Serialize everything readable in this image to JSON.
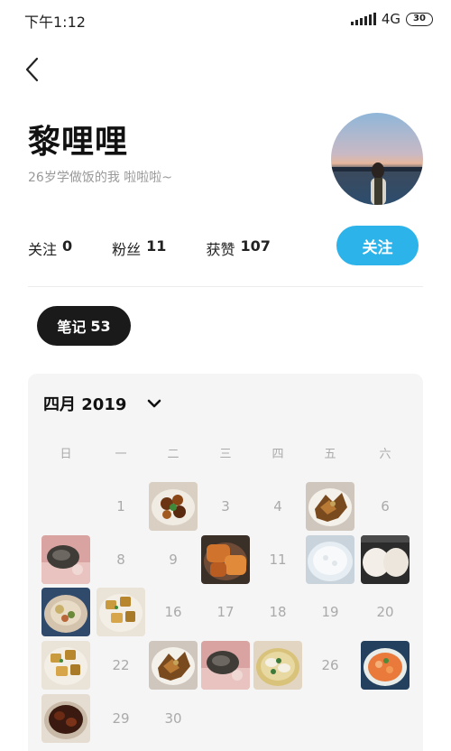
{
  "status_bar": {
    "time": "下午1:12",
    "network": "4G",
    "battery": "30"
  },
  "profile": {
    "name": "黎哩哩",
    "bio": "26岁学做饭的我 啦啦啦~",
    "stats": [
      {
        "label": "关注",
        "value": "0"
      },
      {
        "label": "粉丝",
        "value": "11"
      },
      {
        "label": "获赞",
        "value": "107"
      }
    ],
    "follow_label": "关注"
  },
  "tab": {
    "label": "笔记",
    "count": "53"
  },
  "calendar": {
    "month_label": "四月 2019",
    "weekdays": [
      "日",
      "一",
      "二",
      "三",
      "四",
      "五",
      "六"
    ],
    "days": [
      {
        "num": "1",
        "photo": null
      },
      {
        "num": "2",
        "photo": "braised-meat"
      },
      {
        "num": "3",
        "photo": null
      },
      {
        "num": "4",
        "photo": null
      },
      {
        "num": "5",
        "photo": "stir-fry"
      },
      {
        "num": "6",
        "photo": null
      },
      {
        "num": "7",
        "photo": "fish"
      },
      {
        "num": "8",
        "photo": null
      },
      {
        "num": "9",
        "photo": null
      },
      {
        "num": "10",
        "photo": "glazed-pork"
      },
      {
        "num": "11",
        "photo": null
      },
      {
        "num": "12",
        "photo": "rice"
      },
      {
        "num": "13",
        "photo": "buns"
      },
      {
        "num": "14",
        "photo": "noodles"
      },
      {
        "num": "15",
        "photo": "potatoes"
      },
      {
        "num": "16",
        "photo": null
      },
      {
        "num": "17",
        "photo": null
      },
      {
        "num": "18",
        "photo": null
      },
      {
        "num": "19",
        "photo": null
      },
      {
        "num": "20",
        "photo": null
      },
      {
        "num": "21",
        "photo": "potatoes"
      },
      {
        "num": "22",
        "photo": null
      },
      {
        "num": "23",
        "photo": "stir-fry"
      },
      {
        "num": "24",
        "photo": "fish"
      },
      {
        "num": "25",
        "photo": "dumplings"
      },
      {
        "num": "26",
        "photo": null
      },
      {
        "num": "27",
        "photo": "soup"
      },
      {
        "num": "28",
        "photo": "cola-wings"
      },
      {
        "num": "29",
        "photo": null
      },
      {
        "num": "30",
        "photo": null
      }
    ]
  },
  "colors": {
    "accent": "#2bb3ea",
    "dark_pill": "#1a1a1a",
    "muted_text": "#aaaaaa"
  }
}
